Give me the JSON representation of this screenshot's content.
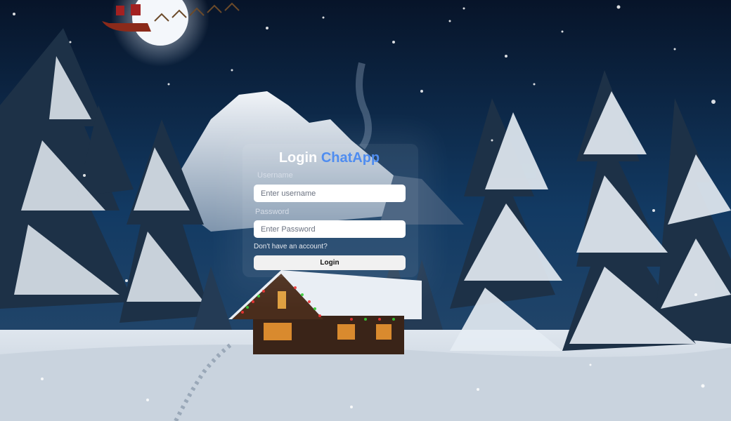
{
  "login": {
    "title_prefix": "Login",
    "title_brand": "ChatApp",
    "username_label": "Username",
    "username_placeholder": "Enter username",
    "password_label": "Password",
    "password_placeholder": "Enter Password",
    "signup_link": "Don't have an account?",
    "submit_label": "Login"
  },
  "colors": {
    "brand": "#4f8df0",
    "sky": "#0b1a33",
    "button": "#f1f1f1"
  }
}
